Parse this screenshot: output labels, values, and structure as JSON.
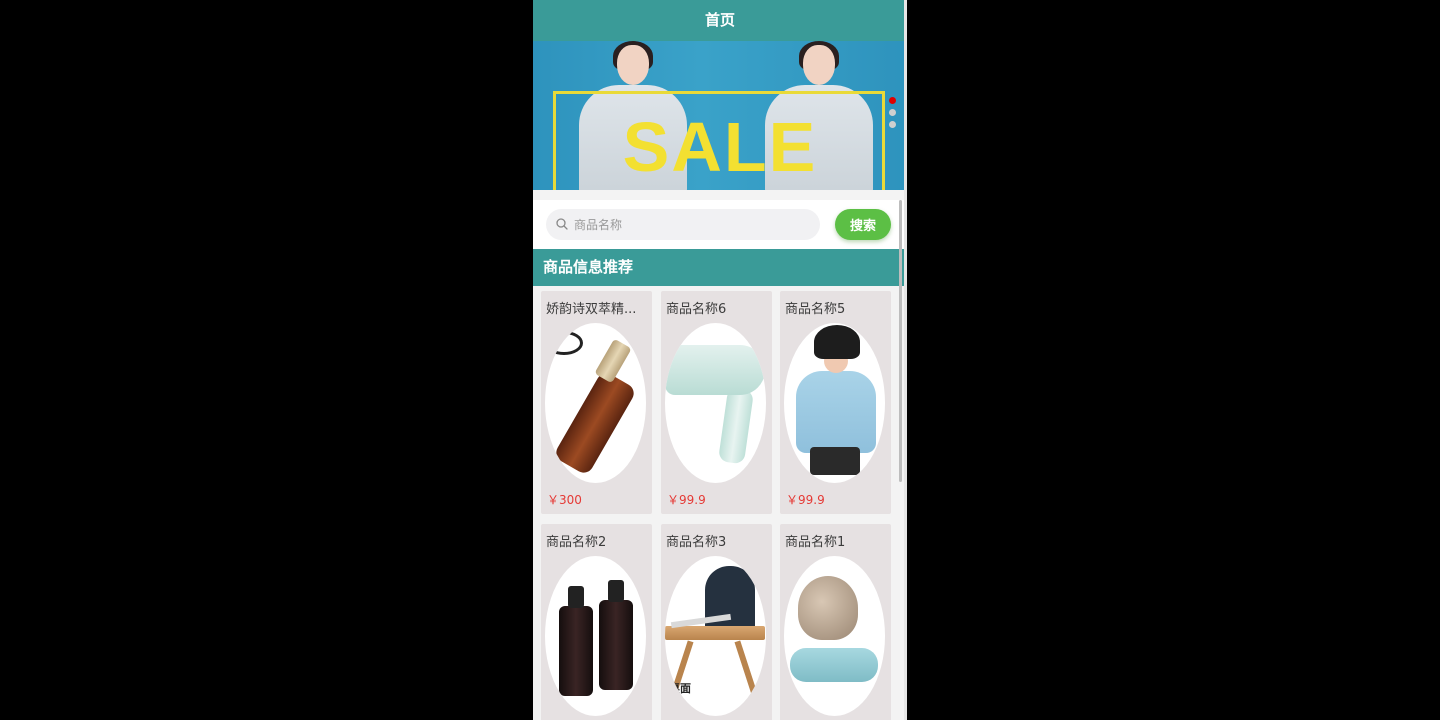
{
  "header": {
    "title": "首页"
  },
  "banner": {
    "text": "SALE",
    "frame_color": "#e9da38",
    "indicator_active_color": "#e00000",
    "indicator_inactive_color": "#cfcfcf"
  },
  "search": {
    "placeholder": "商品名称",
    "value": "",
    "button_label": "搜索",
    "icon": "search-icon"
  },
  "section": {
    "title": "商品信息推荐"
  },
  "products": [
    {
      "name": "娇韵诗双萃精...",
      "price": "￥300"
    },
    {
      "name": "商品名称6",
      "price": "￥99.9"
    },
    {
      "name": "商品名称5",
      "price": "￥99.9"
    },
    {
      "name": "商品名称2",
      "price": ""
    },
    {
      "name": "商品名称3",
      "price": "",
      "image_caption": "桌面"
    },
    {
      "name": "商品名称1",
      "price": ""
    }
  ],
  "colors": {
    "header": "#3a9b98",
    "search_button": "#5cbf45",
    "price": "#e53935",
    "card_bg": "#e6e1e2"
  }
}
